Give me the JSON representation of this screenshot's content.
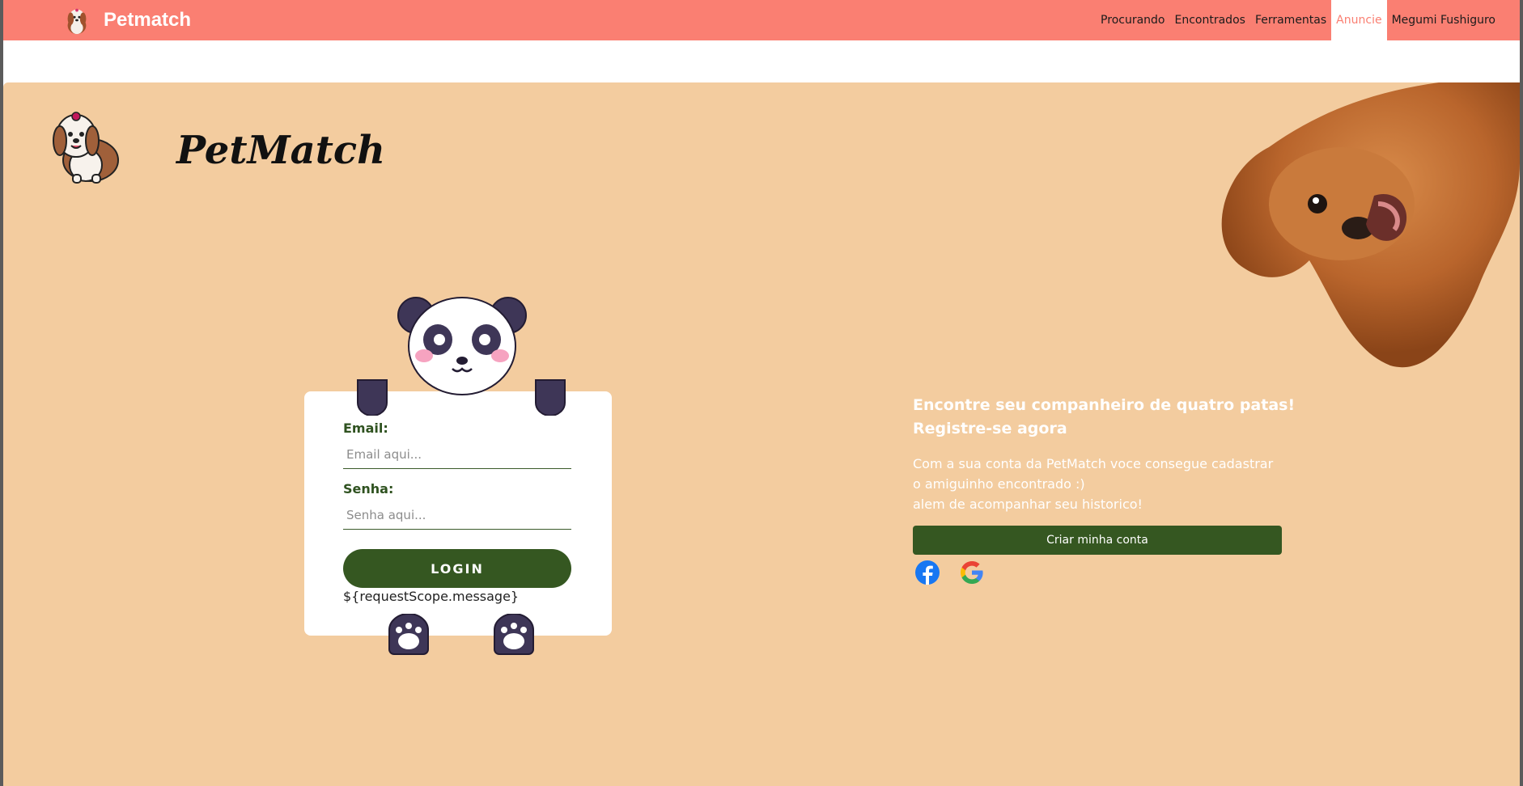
{
  "navbar": {
    "brand": "Petmatch",
    "items": [
      "Procurando",
      "Encontrados",
      "Ferramentas",
      "Anuncie",
      "Megumi Fushiguro"
    ],
    "active_index": 3
  },
  "hero": {
    "title": "PetMatch"
  },
  "login": {
    "email_label": "Email:",
    "email_placeholder": "Email aqui...",
    "password_label": "Senha:",
    "password_placeholder": "Senha aqui...",
    "login_button": "LOGIN",
    "message": "${requestScope.message}"
  },
  "promo": {
    "headline_1": "Encontre seu companheiro de quatro patas!",
    "headline_2": "Registre-se agora",
    "text_1": "Com a sua conta da PetMatch voce consegue cadastrar",
    "text_2": "o amiguinho encontrado :)",
    "text_3": "alem de acompanhar seu historico!",
    "create_button": "Criar minha conta",
    "social": [
      "facebook-icon",
      "google-icon"
    ]
  },
  "colors": {
    "navbar": "#fa7f72",
    "background": "#f3cc9f",
    "primary_green": "#355721",
    "panda_dark": "#3e3657"
  }
}
